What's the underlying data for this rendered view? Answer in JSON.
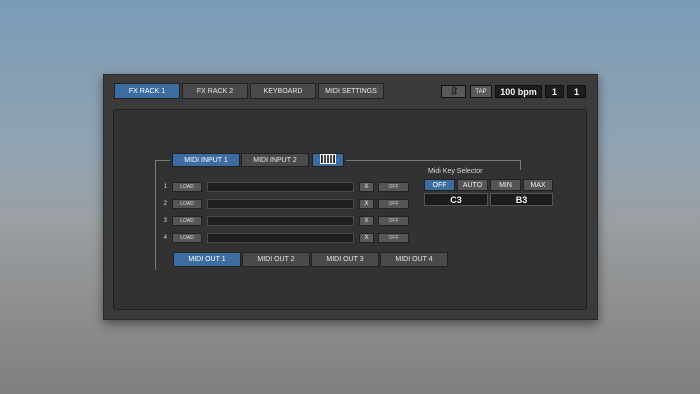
{
  "top_tabs": [
    {
      "label": "FX RACK 1",
      "active": true
    },
    {
      "label": "FX RACK 2",
      "active": false
    },
    {
      "label": "KEYBOARD",
      "active": false
    },
    {
      "label": "MIDI SETTINGS",
      "active": false
    }
  ],
  "transport": {
    "metronome_icon": "metronome-icon",
    "tap_label": "TAP",
    "bpm": "100 bpm",
    "bar": "1",
    "beat": "1"
  },
  "midi_input_tabs": [
    {
      "label": "MIDI INPUT 1",
      "active": true
    },
    {
      "label": "MIDI INPUT 2",
      "active": false
    }
  ],
  "keyboard_icon": "piano-keys-icon",
  "slots": [
    {
      "number": "1",
      "load_label": "LOAD",
      "remove_label": "X",
      "toggle_label": "OFF"
    },
    {
      "number": "2",
      "load_label": "LOAD",
      "remove_label": "X",
      "toggle_label": "OFF"
    },
    {
      "number": "3",
      "load_label": "LOAD",
      "remove_label": "X",
      "toggle_label": "OFF"
    },
    {
      "number": "4",
      "load_label": "LOAD",
      "remove_label": "X",
      "toggle_label": "OFF"
    }
  ],
  "key_selector": {
    "title": "Midi Key Selector",
    "modes": [
      {
        "label": "OFF",
        "active": true
      },
      {
        "label": "AUTO",
        "active": false
      },
      {
        "label": "MIN",
        "active": false
      },
      {
        "label": "MAX",
        "active": false
      }
    ],
    "low_key": "C3",
    "high_key": "B3"
  },
  "midi_out_tabs": [
    {
      "label": "MIDI OUT 1",
      "active": true
    },
    {
      "label": "MIDI OUT 2",
      "active": false
    },
    {
      "label": "MIDI OUT 3",
      "active": false
    },
    {
      "label": "MIDI OUT 4",
      "active": false
    }
  ],
  "colors": {
    "accent": "#3d6da0",
    "window_bg": "#3b3b3b",
    "panel_bg": "#323232"
  }
}
